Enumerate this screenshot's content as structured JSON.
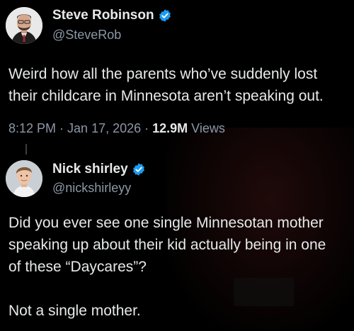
{
  "tweets": [
    {
      "display_name": "Steve Robinson",
      "handle": "@SteveRob",
      "text": "Weird how all the parents who’ve suddenly lost\ntheir childcare in Minnesota aren’t speaking out.",
      "time": "8:12 PM",
      "separator": "·",
      "date": "Jan 17, 2026",
      "views_count": "12.9M",
      "views_label": "Views",
      "verified_icon": "verified-badge-icon"
    },
    {
      "display_name": "Nick shirley",
      "handle": "@nickshirleyy",
      "text": "Did you ever see one single Minnesotan mother\nspeaking up about their kid actually being in one\nof these “Daycares”?\n\nNot a single mother.",
      "verified_icon": "verified-badge-icon"
    }
  ],
  "colors": {
    "background": "#000000",
    "text": "#e7e9ea",
    "secondary_text": "#8b98a5",
    "verified": "#1d9bf0"
  }
}
